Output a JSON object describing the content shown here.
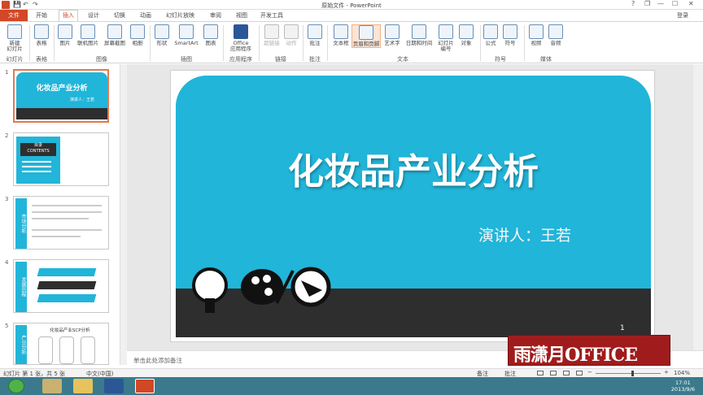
{
  "window": {
    "title": "原始文件 - PowerPoint",
    "controls": [
      "?",
      "❐",
      "—",
      "☐",
      "✕"
    ]
  },
  "quick_access": {
    "save": "💾",
    "undo": "↶",
    "redo": "↷"
  },
  "tabs": [
    {
      "label": "文件"
    },
    {
      "label": "开始"
    },
    {
      "label": "插入"
    },
    {
      "label": "设计"
    },
    {
      "label": "切换"
    },
    {
      "label": "动画"
    },
    {
      "label": "幻灯片放映"
    },
    {
      "label": "审阅"
    },
    {
      "label": "视图"
    },
    {
      "label": "开发工具"
    }
  ],
  "account": {
    "label": "登录"
  },
  "ribbon": {
    "buttons": [
      {
        "label": "新建\n幻灯片"
      },
      {
        "label": "表格"
      },
      {
        "label": "图片"
      },
      {
        "label": "联机图片"
      },
      {
        "label": "屏幕截图"
      },
      {
        "label": "相册"
      },
      {
        "label": "形状"
      },
      {
        "label": "SmartArt"
      },
      {
        "label": "图表"
      },
      {
        "label": "Office\n应用程序"
      },
      {
        "label": "超链接"
      },
      {
        "label": "动作"
      },
      {
        "label": "批注"
      },
      {
        "label": "文本框"
      },
      {
        "label": "页眉和页脚"
      },
      {
        "label": "艺术字"
      },
      {
        "label": "日期和时间"
      },
      {
        "label": "幻灯片\n编号"
      },
      {
        "label": "对象"
      },
      {
        "label": "公式"
      },
      {
        "label": "符号"
      },
      {
        "label": "视频"
      },
      {
        "label": "音频"
      }
    ],
    "groups": [
      "幻灯片",
      "表格",
      "图像",
      "插图",
      "应用程序",
      "链接",
      "批注",
      "文本",
      "符号",
      "媒体"
    ]
  },
  "thumbnails": [
    {
      "num": "1",
      "title": "化妆品产业分析",
      "sub": "演讲人：王若"
    },
    {
      "num": "2",
      "title": "目录",
      "sub": "CONTENTS"
    },
    {
      "num": "3",
      "title": "市场分析"
    },
    {
      "num": "4",
      "title": "发展历程"
    },
    {
      "num": "5",
      "title": "化妆品产业SCP分析",
      "side": "产业分析"
    }
  ],
  "slide": {
    "title": "化妆品产业分析",
    "subtitle": "演讲人：王若",
    "number": "1"
  },
  "notes": {
    "placeholder": "单击此处添加备注"
  },
  "status": {
    "slide_info": "幻灯片 第 1 张，共 5 张",
    "language": "中文(中国)",
    "notes_btn": "备注",
    "comments_btn": "批注",
    "zoom": "104%"
  },
  "taskbar": {
    "time": "17:01",
    "date": "2013/9/6"
  },
  "watermark": {
    "text": "雨潇月OFFICE"
  },
  "colors": {
    "accent": "#d24726",
    "slide_blue": "#21b5d9",
    "slide_dark": "#2e2e2e"
  }
}
